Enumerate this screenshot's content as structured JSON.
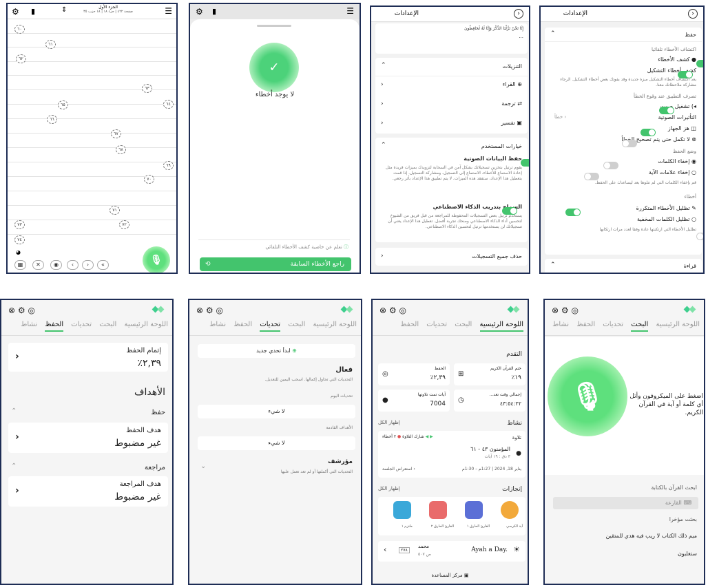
{
  "p1": {
    "top_title": "الجزء الأول",
    "top_sub": "صفحة ٤٢٢ | جزء ١٨ | ١٨ حزب ٣٥",
    "markers": [
      "٦٠",
      "٦١",
      "٦٢",
      "٦٣",
      "٦٤",
      "٦٥",
      "٦٦",
      "٦٧",
      "٦٨",
      "٦٩",
      "٧٠",
      "٧١",
      "٧٢",
      "٧٣",
      "٧٤"
    ]
  },
  "p2": {
    "no_errors": "لا يوجد أخطاء",
    "hint": "تعلم عن خاصية كشف الأخطاء التلقائي",
    "review_button": "راجع الأخطاء السابقة"
  },
  "p3": {
    "title": "الإعدادات",
    "preview_text": "إِنَّا نَحْنُ نَزَّلْنَا الذِّكْرَ وَإِنَّا لَهُ لَحَافِظُونَ",
    "preview_dots": "...",
    "downloads": "التنزيلات",
    "reciters": "القراء",
    "translation": "ترجمة",
    "tafsir": "تفسير",
    "user_options": "خيارات المستخدم",
    "save_voice": "حفظ البيانات الصوتية",
    "save_voice_desc": "يقوم ترتيل بتخزين تسجيلاتك بشكل آمن في السحابة لتزويدك بميزات فريدة مثل إعادة الاستماع للأخطاء، الاستماع إلى التسجيل، ومشاركة التسجيل. إذا قمت بتعطيل هذا الإعداد، ستفقد هذه الميزات. لا يتم تطبيق هذا الإعداد بأثر رجعي.",
    "ai_training": "السماح بتدريب الذكاء الاصطناعي",
    "ai_training_desc": "يستخدم ترتيل بعض التسجيلات المحفوظة للمراجعة من قبل فريق من الشيوخ لتحسين أداء الذكاء الاصطناعي ومنحك تجربة أفضل. تعطيل هذا الإعداد يعني أن تسجيلاتك لن يستخدمها ترتيل لتحسين الذكاء الاصطناعي.",
    "delete_all": "حذف جميع التسجيلات"
  },
  "p4": {
    "title": "الإعدادات",
    "memorization": "حفظ",
    "auto_detect": "اكتشاف الأخطاء تلقائيا",
    "detect_errors": "كشف الأخطاء",
    "detect_tashkeel": "كشف أخطاء التشكيل",
    "tashkeel_desc": "يعد اكتشاف أخطاء التشكيل ميزة جديدة وقد يفوتك بعض أخطاء التشكيل. الرجاء مشاركة ملاحظاتك معنا.",
    "app_behavior": "تصرف التطبيق عند وقوع الخطأ",
    "play_sound": "تشغيل صوت",
    "sound_effects": "التأثيرات الصوتية",
    "sound_effects_value": "خطأ",
    "vibrate": "هز الجهاز",
    "dont_continue": "لا تكمل حتى يتم تصحيح الخطأ",
    "hide_mode": "وضع الحفظ",
    "hide_words": "إخفاء الكلمات",
    "hide_ayah_marks": "إخفاء علامات الآية",
    "hide_desc": "قم بإخفاء الكلمات التي لم تتلوها بعد ليساعدك على الحفظ.",
    "errors": "أخطاء",
    "highlight_repeated": "تظليل الأخطاء المتكررة",
    "highlight_hidden": "تظليل الكلمات المخفية",
    "highlight_desc": "تظليل الأخطاء التي ارتكبتها عادة وفقا لعدد مرات ارتكابها",
    "reading": "قراءة"
  },
  "p5": {
    "tabs": [
      "نشاط",
      "الحفظ",
      "تحديات",
      "البحث",
      "اللوحة الرئيسية"
    ],
    "completion_label": "إتمام الحفظ",
    "completion_value": "٢,٣٩٪",
    "goals": "الأهداف",
    "hifz": "حفظ",
    "hifz_goal": "هدف الحفظ",
    "not_set": "غير مضبوط",
    "review": "مراجعة",
    "review_goal": "هدف المراجعة",
    "not_set2": "غير مضبوط"
  },
  "p6": {
    "tabs": [
      "نشاط",
      "الحفظ",
      "تحديات",
      "البحث",
      "اللوحة الرئيسية"
    ],
    "new_challenge": "ابدأ تحدي جديد",
    "active": "فعال",
    "active_desc": "التحديات التي تحاول إكمالها. اسحب اليمين للتعديل.",
    "today": "تحديات اليوم",
    "none1": "لا شيء",
    "upcoming": "الأهداف القادمة",
    "none2": "لا شيء",
    "archived": "مؤرشف",
    "archived_desc": "التحديات التي أكملتها أو لم تعد تعمل عليها"
  },
  "p7": {
    "tabs": [
      "الحفظ",
      "تحديات",
      "البحث",
      "اللوحة الرئيسية"
    ],
    "progress": "التقدم",
    "khatm": "ختم القرآن الكريم",
    "khatm_val": "١٩٪",
    "hifz": "الحفظ",
    "hifz_val": "٢,٣٩٪",
    "total_time": "إجمالي وقت تعد...",
    "total_time_val": "٤٣:٥٤:٢٢",
    "ayat": "آيات تمت تلاوتها",
    "ayat_val": "7004",
    "activity": "نشاط",
    "show_all": "إظهار الكل",
    "tilawa": "تلاوة",
    "share": "شارك التلاوة",
    "mistakes": "٢ أخطاء",
    "surah": "المؤمنون ٤٣ - ٦١",
    "surah_sub": "٣ دق : ١٩ آيات",
    "date": "يناير 18, 2024 | 1:27م – 1:30م",
    "session": "استعراض الجلسة",
    "achievements": "إنجازات",
    "show_all2": "إظهار الكل",
    "badges": [
      "آية الكرسي",
      "القارئ الحارق ١",
      "القارئ الحارق ٢",
      "ملتزم ١"
    ],
    "ayah_day": "Ayah a Day.",
    "name": "محمد",
    "ayah_ref": "ص ٥٠٧",
    "ayah_box": "٢٧٨",
    "help": "مركز المساعدة"
  },
  "p8": {
    "tabs": [
      "نشاط",
      "الحفظ",
      "تحديات",
      "البحث",
      "اللوحة الرئيسية"
    ],
    "mic_prompt": "اضغط على الميكروفون وأتل أي كلمة أو آية في القرآن الكريم.",
    "search_text": "ابحث القرآن بالكتابة",
    "search_placeholder": "القارعة",
    "recent": "بحثت مؤخرا",
    "recent1": "ميم ذلك الكتاب لا ريب فيه هدي للمتقين",
    "recent2": "ستغلبون"
  }
}
